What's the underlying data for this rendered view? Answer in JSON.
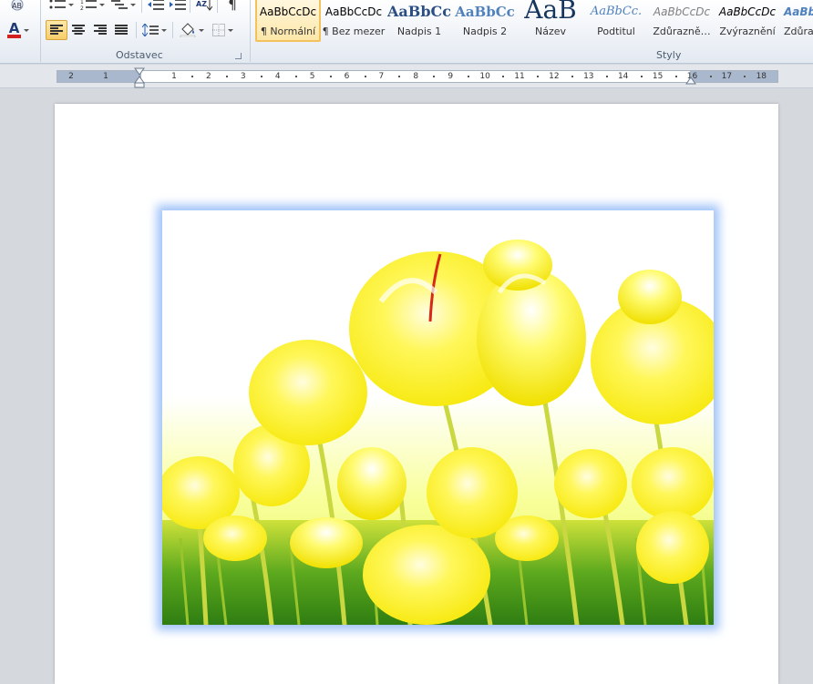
{
  "ribbon": {
    "paragraph_group_label": "Odstavec",
    "styles_group_label": "Styly",
    "font_color_letter": "A",
    "sort_letters": "AZ",
    "pilcrow": "¶"
  },
  "styles": [
    {
      "sample": "AaBbCcDc",
      "name": "¶ Normální",
      "selected": true
    },
    {
      "sample": "AaBbCcDc",
      "name": "¶ Bez mezer",
      "selected": false
    },
    {
      "sample": "AaBbCc",
      "name": "Nadpis 1",
      "selected": false
    },
    {
      "sample": "AaBbCc",
      "name": "Nadpis 2",
      "selected": false
    },
    {
      "sample": "AaB",
      "name": "Název",
      "selected": false
    },
    {
      "sample": "AaBbCc.",
      "name": "Podtitul",
      "selected": false
    },
    {
      "sample": "AaBbCcDc",
      "name": "Zdůrazně…",
      "selected": false
    },
    {
      "sample": "AaBbCcDc",
      "name": "Zvýraznění",
      "selected": false
    },
    {
      "sample": "AaBb",
      "name": "Zdůra",
      "selected": false
    }
  ],
  "ruler": {
    "left_numbers": [
      "2",
      "1"
    ],
    "numbers": [
      "1",
      "2",
      "3",
      "4",
      "5",
      "6",
      "7",
      "8",
      "9",
      "10",
      "11",
      "12",
      "13",
      "14",
      "15",
      "16",
      "17",
      "18"
    ]
  },
  "colors": {
    "accent_font_color": "#d41f1f",
    "photo_glow": "#82aff5",
    "selected_style": "#f2c35c"
  }
}
